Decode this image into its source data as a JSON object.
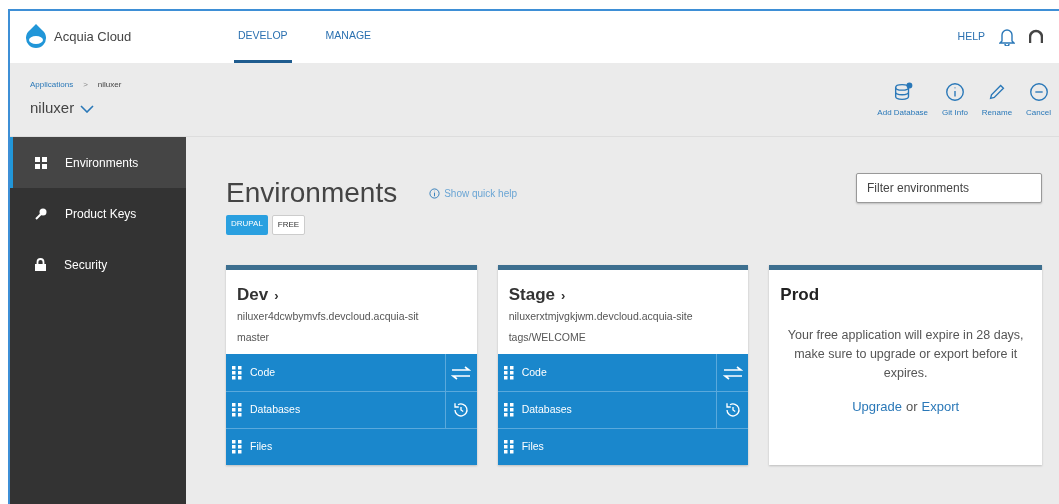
{
  "brand": {
    "name": "Acquia Cloud"
  },
  "top_nav": [
    {
      "label": "DEVELOP",
      "selected": true
    },
    {
      "label": "MANAGE",
      "selected": false
    }
  ],
  "top_right": {
    "help": "HELP"
  },
  "breadcrumb": [
    {
      "label": "Applications",
      "kind": "link"
    },
    {
      "label": ">",
      "kind": "separator"
    },
    {
      "label": "niluxer",
      "kind": "current"
    }
  ],
  "app_title": "niluxer",
  "actions": [
    {
      "label": "Add Database",
      "kind": "database"
    },
    {
      "label": "Git Info",
      "kind": "info"
    },
    {
      "label": "Rename",
      "kind": "pencil"
    },
    {
      "label": "Cancel",
      "kind": "cancel"
    }
  ],
  "sidebar": {
    "items": [
      {
        "label": "Environments",
        "kind": "grid",
        "selected": true
      },
      {
        "label": "Product Keys",
        "kind": "key",
        "selected": false
      },
      {
        "label": "Security",
        "kind": "lock",
        "selected": false
      }
    ]
  },
  "page": {
    "title": "Environments",
    "help_link": "Show quick help",
    "tags": [
      {
        "label": "DRUPAL",
        "kind": "primary"
      },
      {
        "label": "FREE",
        "kind": "outline"
      }
    ],
    "filter": {
      "placeholder": "Filter environments"
    }
  },
  "environments": [
    {
      "kind": "active",
      "name": "Dev",
      "chevron": "›",
      "host": "niluxer4dcwbymvfs.devcloud.acquia-sit",
      "branch": "master",
      "rows": [
        {
          "label": "Code",
          "kind": "swap"
        },
        {
          "label": "Databases",
          "kind": "history"
        },
        {
          "label": "Files",
          "kind": "plain"
        }
      ]
    },
    {
      "kind": "active",
      "name": "Stage",
      "chevron": "›",
      "host": "niluxerxtmjvgkjwm.devcloud.acquia-site",
      "branch": "tags/WELCOME",
      "rows": [
        {
          "label": "Code",
          "kind": "swap"
        },
        {
          "label": "Databases",
          "kind": "history"
        },
        {
          "label": "Files",
          "kind": "plain"
        }
      ]
    },
    {
      "kind": "locked",
      "name": "Prod",
      "message": "Your free application will expire in 28 days, make sure to upgrade or export before it expires.",
      "links": [
        {
          "label": "Upgrade"
        },
        {
          "label": "Export"
        }
      ],
      "joiner": "or"
    }
  ]
}
